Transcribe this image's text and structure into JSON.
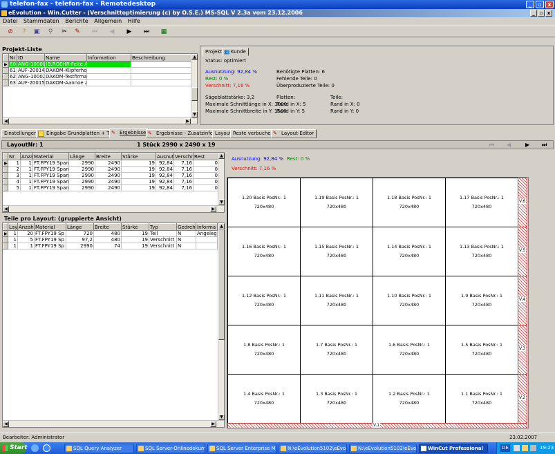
{
  "rdp_window": {
    "title": "telefon-fax - telefon-fax - Remotedesktop"
  },
  "app_window": {
    "title": "eEvolution - Win.Cutter - (Verschnittoptimierung (c) by O.S.E.) MS-SQL V 2.3a vom 23.12.2006"
  },
  "menu": [
    "Datei",
    "Stammdaten",
    "Berichte",
    "Allgemein",
    "Hilfe"
  ],
  "toolbar": [
    "stop-icon",
    "help-icon",
    "save-icon",
    "pin-icon",
    "scissors-icon",
    "edit-icon",
    "first-icon",
    "prev-icon",
    "next-icon",
    "last-icon",
    "calculator-icon"
  ],
  "projekt_liste": {
    "caption": "Projekt-Liste",
    "columns": [
      "Nr",
      "ID",
      "Name",
      "Information",
      "Beschreibung"
    ],
    "rows": [
      {
        "nr": "60",
        "id": "ANG-10000",
        "name": "(B.ROEHR-Feite Adi",
        "info": "",
        "desc": "",
        "selected": true
      },
      {
        "nr": "61",
        "id": "AUF-20014",
        "name": "DAKOM-Klipferholz",
        "info": "",
        "desc": "",
        "selected": false
      },
      {
        "nr": "62",
        "id": "ANG-10002",
        "name": "DAKOM-Testfirma-A",
        "info": "",
        "desc": "",
        "selected": false
      },
      {
        "nr": "63",
        "id": "AUF-20015",
        "name": "DAKOM-Aannoe A/",
        "info": "",
        "desc": "",
        "selected": false
      }
    ]
  },
  "info": {
    "tabs": [
      "Projekt",
      "Kunde"
    ],
    "status": "Status:  optimiert",
    "ausnutzung": "Ausnutzung: 92,84 %",
    "rest": "Rest: 0 %",
    "verschnitt": "Verschnitt: 7,16 %",
    "benoetigte": "Benötigte Platten: 6",
    "fehlende": "Fehlende Teile: 0",
    "ueberproduziert": "Überproduzierte Teile: 0",
    "saege": "Sägeblattstärke: 3,2",
    "max_x": "Maximale Schnittlänge in X: 3000",
    "max_y": "Maximale Schnittbreite in Y: 1500",
    "platten": "Platten:",
    "platten_rx": "Rand in X: 5",
    "platten_ry": "Rand in Y: 5",
    "teile": "Teile:",
    "teile_rx": "Rand in X: 0",
    "teile_ry": "Rand in Y: 0"
  },
  "main_tabs": [
    "Einstellungen",
    "Eingabe Grundplatten + Teile",
    "Ergebnisse",
    "Ergebnisse - Zusatzinfos",
    "Layout",
    "Reste verbuchen",
    "Layout-Editor"
  ],
  "layout": {
    "nr": "LayoutNr: 1",
    "stueck": "1 Stück 2990 x 2490 x 19"
  },
  "layout_grid": {
    "columns": [
      "Nr",
      "Anzahl",
      "Material",
      "Länge",
      "Breite",
      "Stärke",
      "Ausnutz",
      "Verschn",
      "Rest"
    ],
    "rows": [
      [
        "1",
        "1",
        "FT.FPY19 Spang",
        "2990",
        "2490",
        "19",
        "92,84",
        "7,16",
        "0"
      ],
      [
        "2",
        "1",
        "FT.FPY19 Spang",
        "2990",
        "2490",
        "19",
        "92,84",
        "7,16",
        "0"
      ],
      [
        "3",
        "1",
        "FT.FPY19 Spang",
        "2990",
        "2490",
        "19",
        "92,84",
        "7,16",
        "0"
      ],
      [
        "4",
        "1",
        "FT.FPY19 Spang",
        "2990",
        "2490",
        "19",
        "92,84",
        "7,16",
        "0"
      ],
      [
        "5",
        "1",
        "FT.FPY19 Spang",
        "2990",
        "2490",
        "19",
        "92,84",
        "7,16",
        "0"
      ]
    ]
  },
  "teile": {
    "caption": "Teile pro Layout: (gruppierte Ansicht)",
    "columns": [
      "Layo",
      "Anzahl",
      "Material",
      "Länge",
      "Breite",
      "Stärke",
      "Typ",
      "Gedreht",
      "Informa"
    ],
    "rows": [
      [
        "1",
        "20",
        "FT.FPY19 Sp",
        "720",
        "480",
        "19",
        "Teil",
        "N",
        "Angeleg"
      ],
      [
        "1",
        "5",
        "FT.FPY19 Sp",
        "97,2",
        "480",
        "19",
        "Verschnitt",
        "N",
        ""
      ],
      [
        "1",
        "1",
        "FT.FPY19 Sp",
        "2990",
        "74",
        "19",
        "Verschnitt",
        "N",
        ""
      ]
    ]
  },
  "layout_info": {
    "ausnutzung": "Ausnutzung: 92,84 %",
    "rest": "Rest: 0 %",
    "verschnitt": "Verschnitt: 7,16 %"
  },
  "pieces": [
    [
      "1.20 Basis PosNr.: 1",
      "1.19 Basis PosNr.: 1",
      "1.18 Basis PosNr.: 1",
      "1.17 Basis PosNr.: 1"
    ],
    [
      "1.16 Basis PosNr.: 1",
      "1.15 Basis PosNr.: 1",
      "1.14 Basis PosNr.: 1",
      "1.13 Basis PosNr.: 1"
    ],
    [
      "1.12 Basis PosNr.: 1",
      "1.11 Basis PosNr.: 1",
      "1.10 Basis PosNr.: 1",
      "1.9 Basis PosNr.: 1"
    ],
    [
      "1.8 Basis PosNr.: 1",
      "1.7 Basis PosNr.: 1",
      "1.6 Basis PosNr.: 1",
      "1.5 Basis PosNr.: 1"
    ],
    [
      "1.4 Basis PosNr.: 1",
      "1.3 Basis PosNr.: 1",
      "1.2 Basis PosNr.: 1",
      "1.1 Basis PosNr.: 1"
    ]
  ],
  "piece_size": "720x480",
  "vlabels": [
    "V.6",
    "V.5",
    "V.4",
    "V.3",
    "V.2",
    "V.1"
  ],
  "status": {
    "user": "Bearbeiter: Administrator",
    "date": "23.02.2007"
  },
  "taskbar": {
    "start": "Start",
    "tasks": [
      "SQL Query Analyzer",
      "SQL Server-Onlinedokum...",
      "SQL Server Enterprise M...",
      "N:\\eEvolution5102\\eEvol...",
      "N:\\eEvolution5102\\eEvol...",
      "WinCut Professional"
    ],
    "lang": "DE",
    "time": "19:23"
  }
}
